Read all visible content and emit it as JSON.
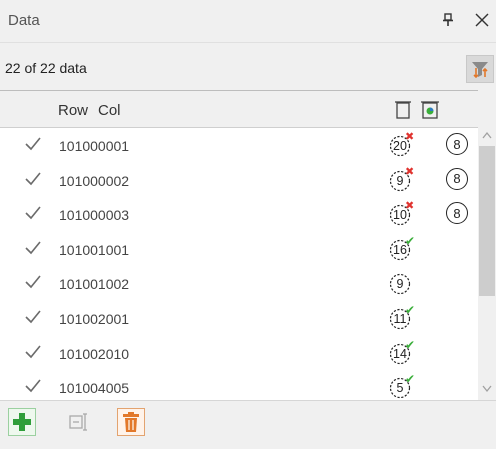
{
  "panel": {
    "title": "Data",
    "pin_icon": "pin-icon",
    "close_icon": "close-icon"
  },
  "summary": {
    "count_text": "22 of 22 data",
    "filter_icon": "filter-sort-icon"
  },
  "table": {
    "headers": {
      "row": "Row",
      "col": "Col"
    },
    "header_icons": [
      "document-icon",
      "document-chart-icon"
    ],
    "rows": [
      {
        "label": "101000001",
        "count": "20",
        "status": "x",
        "extra": "8"
      },
      {
        "label": "101000002",
        "count": "9",
        "status": "x",
        "extra": "8"
      },
      {
        "label": "101000003",
        "count": "10",
        "status": "x",
        "extra": "8"
      },
      {
        "label": "101001001",
        "count": "16",
        "status": "check",
        "extra": ""
      },
      {
        "label": "101001002",
        "count": "9",
        "status": "",
        "extra": ""
      },
      {
        "label": "101002001",
        "count": "11",
        "status": "check",
        "extra": ""
      },
      {
        "label": "101002010",
        "count": "14",
        "status": "check",
        "extra": ""
      },
      {
        "label": "101004005",
        "count": "5",
        "status": "check",
        "extra": ""
      }
    ]
  },
  "toolbar": {
    "add_icon": "plus-icon",
    "edit_icon": "edit-field-icon",
    "delete_icon": "trash-icon"
  },
  "colors": {
    "error": "#e0332f",
    "ok": "#3aae3a",
    "add": "#2f9e3a",
    "delete": "#e2782a"
  }
}
